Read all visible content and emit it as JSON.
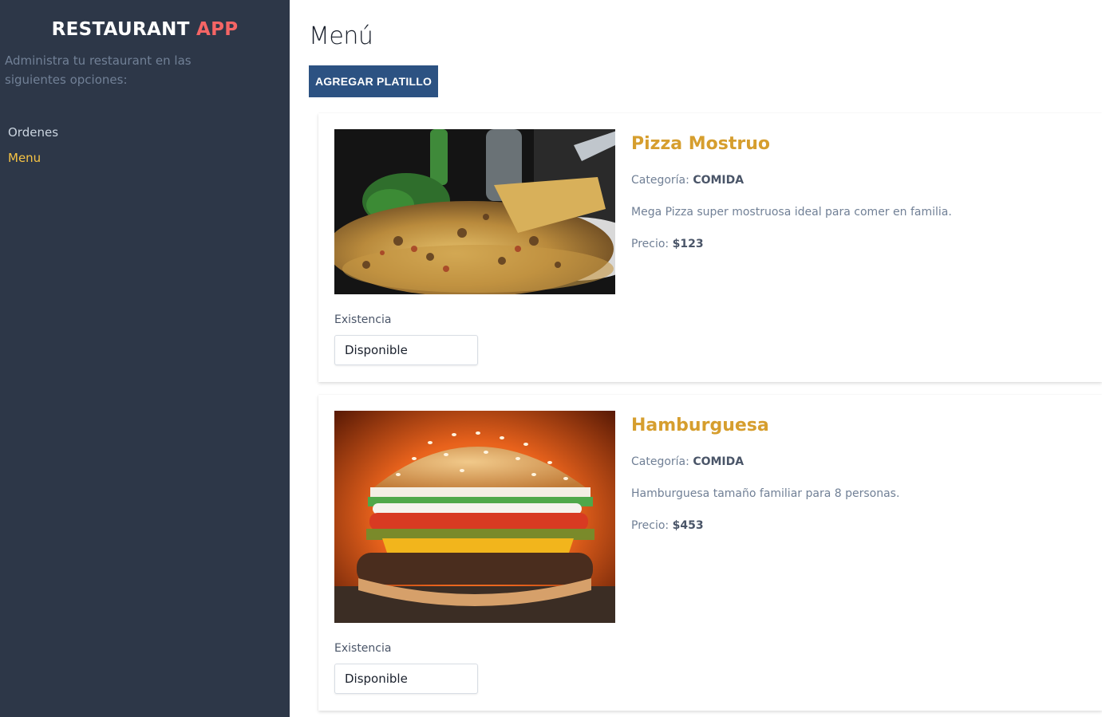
{
  "sidebar": {
    "brand_main": "RESTAURANT",
    "brand_accent": "APP",
    "description": "Administra tu restaurant en las siguientes opciones:",
    "nav": [
      {
        "label": "Ordenes"
      },
      {
        "label": "Menu",
        "active": true
      }
    ]
  },
  "main": {
    "title": "Menú",
    "add_button": "AGREGAR PLATILLO",
    "items": [
      {
        "name": "Pizza Mostruo",
        "category_label": "Categoría:",
        "category": "COMIDA",
        "description": "Mega Pizza super mostruosa ideal para comer en familia.",
        "price_label": "Precio:",
        "price": "$123",
        "stock_label": "Existencia",
        "stock_value": "Disponible"
      },
      {
        "name": "Hamburguesa",
        "category_label": "Categoría:",
        "category": "COMIDA",
        "description": "Hamburguesa tamaño familiar para 8 personas.",
        "price_label": "Precio:",
        "price": "$453",
        "stock_label": "Existencia",
        "stock_value": "Disponible"
      }
    ]
  },
  "colors": {
    "sidebar_bg": "#2d3748",
    "brand_accent": "#f56565",
    "nav_active": "#f6c344",
    "button_bg": "#2c5282",
    "item_title": "#d69e2e"
  }
}
